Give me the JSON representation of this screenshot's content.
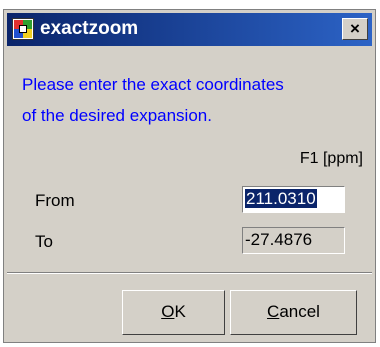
{
  "window": {
    "title": "exactzoom",
    "close_label": "×"
  },
  "message": {
    "line1": "Please enter the exact coordinates",
    "line2": "of the desired expansion."
  },
  "column_header": "F1 [ppm]",
  "rows": [
    {
      "label": "From",
      "value": "211.0310"
    },
    {
      "label": "To",
      "value": "-27.4876"
    }
  ],
  "buttons": {
    "ok_mnemonic": "O",
    "ok_rest": "K",
    "cancel_mnemonic": "C",
    "cancel_rest": "ancel"
  },
  "colors": {
    "title_bar": "#0a246a",
    "message_text": "#0000ff",
    "dialog_bg": "#d4d0c8"
  },
  "icons": {
    "app": "app-grid-icon",
    "close": "close-icon"
  }
}
